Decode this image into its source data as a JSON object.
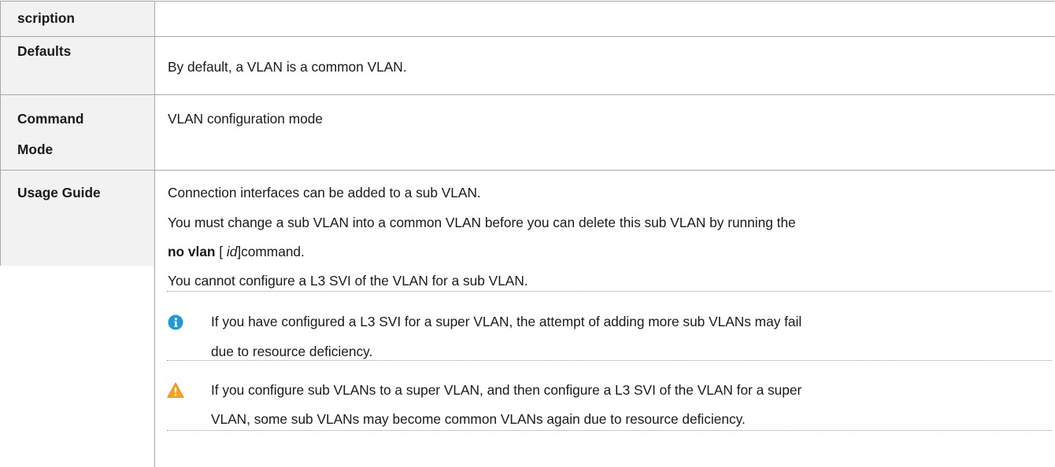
{
  "rows": {
    "description": {
      "label": "scription"
    },
    "defaults": {
      "label": "Defaults",
      "text": "By default, a VLAN is a common VLAN."
    },
    "command_mode": {
      "label_line1": "Command",
      "label_line2": "Mode",
      "text": "VLAN configuration mode"
    },
    "usage_guide": {
      "label": "Usage Guide",
      "line1": "Connection interfaces can be added to a sub VLAN.",
      "line2": "You must change a sub VLAN into a common VLAN before you can delete this sub VLAN by running the",
      "line3_bold": "no vlan",
      "line3_open": " [ ",
      "line3_italic": "id",
      "line3_close": "]command.",
      "line4": "You cannot configure a L3 SVI of the VLAN for a sub VLAN.",
      "note_line1": "If you have configured a L3 SVI for a super VLAN, the attempt of adding more sub VLANs may fail",
      "note_line2": "due to resource deficiency.",
      "caution_line1": "If you configure sub VLANs to a super VLAN, and then configure a L3 SVI of the VLAN for a super",
      "caution_line2": "VLAN, some sub VLANs may become common VLANs again due to resource deficiency."
    }
  },
  "colors": {
    "label_bg": "#f2f2f2",
    "border": "#a8a8a8",
    "info_icon": "#1e9ad6",
    "warning_icon": "#f7a21b"
  }
}
